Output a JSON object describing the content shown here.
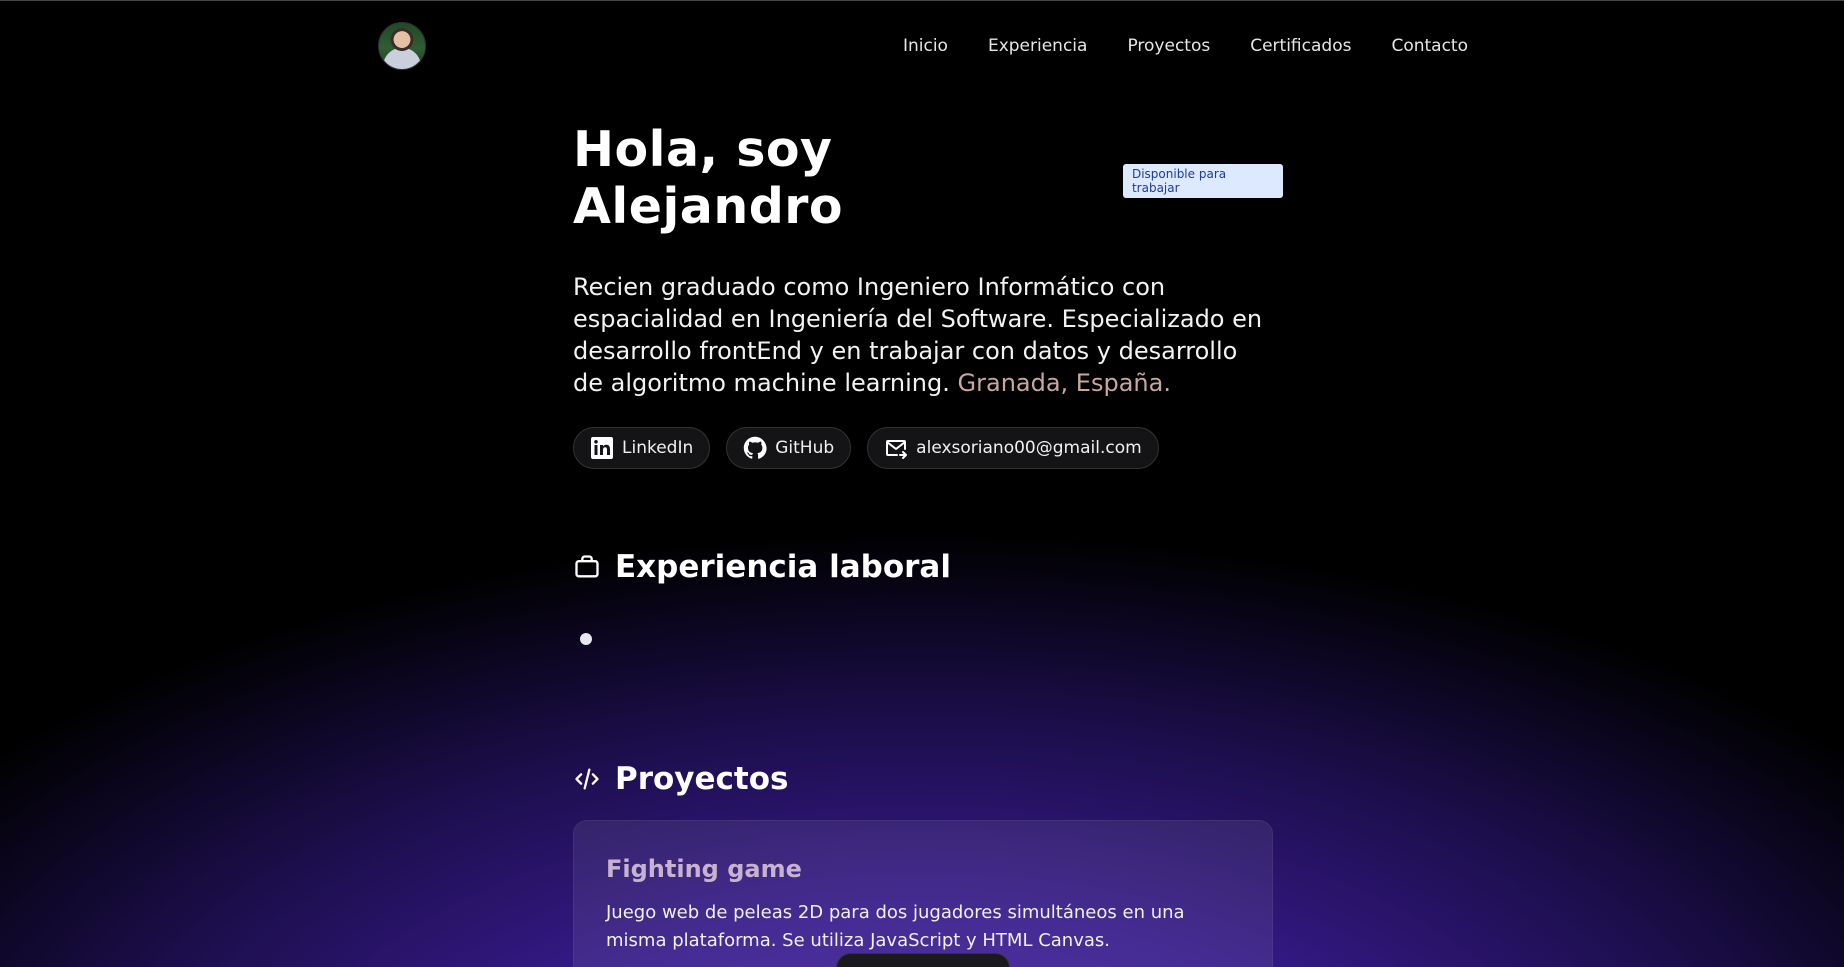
{
  "header": {
    "avatar_alt": "avatar",
    "nav": [
      "Inicio",
      "Experiencia",
      "Proyectos",
      "Certificados",
      "Contacto"
    ]
  },
  "hero": {
    "title": "Hola, soy Alejandro",
    "badge": "Disponible para trabajar",
    "description": "Recien graduado como Ingeniero Informático con espacialidad en Ingeniería del Software. Especializado en desarrollo frontEnd y en trabajar con datos y desarrollo de algoritmo machine learning.",
    "location": "Granada, España.",
    "links": [
      {
        "label": "LinkedIn",
        "icon": "linkedin-icon"
      },
      {
        "label": "GitHub",
        "icon": "github-icon"
      },
      {
        "label": "alexsoriano00@gmail.com",
        "icon": "mail-icon"
      }
    ]
  },
  "experience": {
    "title": "Experiencia laboral",
    "icon": "briefcase-icon"
  },
  "projects": {
    "title": "Proyectos",
    "icon": "code-icon",
    "items": [
      {
        "name": "Fighting game",
        "description": "Juego web de peleas 2D para dos jugadores simultáneos en una misma plataforma. Se utiliza JavaScript y HTML Canvas."
      }
    ]
  },
  "colors": {
    "background": "#000000",
    "accent_gradient": "#4a22b0",
    "badge_bg": "#dde9ff",
    "badge_text": "#1f3d99",
    "location_text": "#c9a7a0",
    "project_title": "#c8b2cf"
  }
}
